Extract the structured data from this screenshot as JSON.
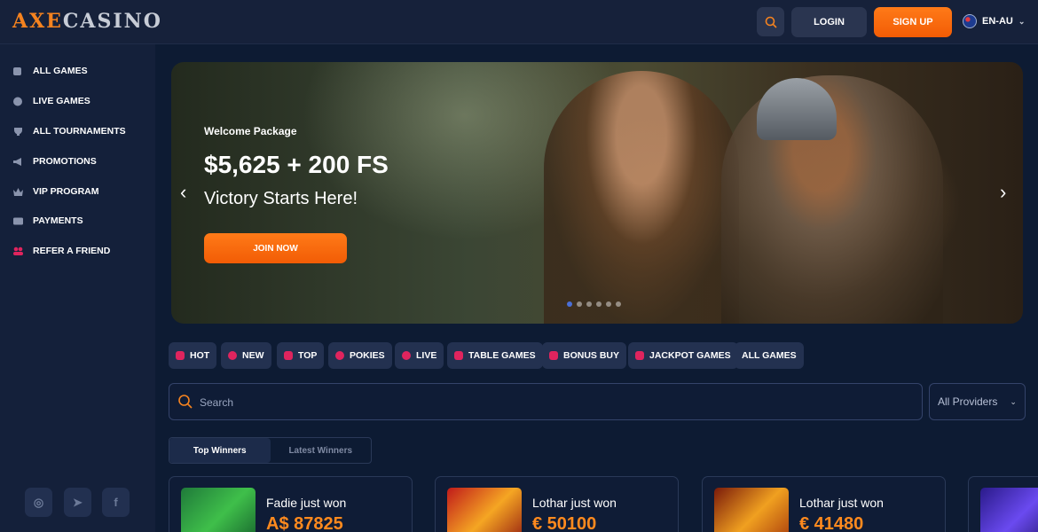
{
  "header": {
    "logo_left": "AXE",
    "logo_right": "CASINO",
    "login": "LOGIN",
    "signup": "SIGN UP",
    "language": "EN-AU"
  },
  "sidebar": {
    "items": [
      {
        "label": "ALL GAMES",
        "icon": "dice-icon"
      },
      {
        "label": "LIVE GAMES",
        "icon": "roulette-icon"
      },
      {
        "label": "ALL TOURNAMENTS",
        "icon": "trophy-icon"
      },
      {
        "label": "PROMOTIONS",
        "icon": "megaphone-icon"
      },
      {
        "label": "VIP PROGRAM",
        "icon": "crown-icon"
      },
      {
        "label": "PAYMENTS",
        "icon": "wallet-icon"
      },
      {
        "label": "REFER A FRIEND",
        "icon": "users-icon"
      }
    ],
    "social": [
      "instagram-icon",
      "telegram-icon",
      "facebook-icon"
    ]
  },
  "banner": {
    "subtitle": "Welcome Package",
    "title": "$5,625 + 200 FS",
    "tagline": "Victory Starts Here!",
    "cta": "JOIN NOW",
    "slide_count": 6,
    "active_slide": 1
  },
  "categories": [
    {
      "label": "HOT",
      "icon": "flame-icon"
    },
    {
      "label": "NEW",
      "icon": "new-badge-icon"
    },
    {
      "label": "TOP",
      "icon": "crown-icon"
    },
    {
      "label": "POKIES",
      "icon": "cherries-icon"
    },
    {
      "label": "LIVE",
      "icon": "live-icon"
    },
    {
      "label": "TABLE GAMES",
      "icon": "cards-icon"
    },
    {
      "label": "BONUS BUY",
      "icon": "gift-icon"
    },
    {
      "label": "JACKPOT GAMES",
      "icon": "seven-icon"
    },
    {
      "label": "ALL GAMES",
      "icon": ""
    }
  ],
  "search": {
    "placeholder": "Search",
    "providers": "All Providers"
  },
  "winners": {
    "tabs": [
      "Top Winners",
      "Latest Winners"
    ],
    "active_tab": 0,
    "cards": [
      {
        "text": "Fadie just won",
        "amount": "A$ 87825"
      },
      {
        "text": "Lothar just won",
        "amount": "€ 50100"
      },
      {
        "text": "Lothar just won",
        "amount": "€ 41480"
      }
    ]
  },
  "colors": {
    "accent": "#f5831f",
    "background": "#0d1b33",
    "chip_icon": "#e0245e"
  }
}
